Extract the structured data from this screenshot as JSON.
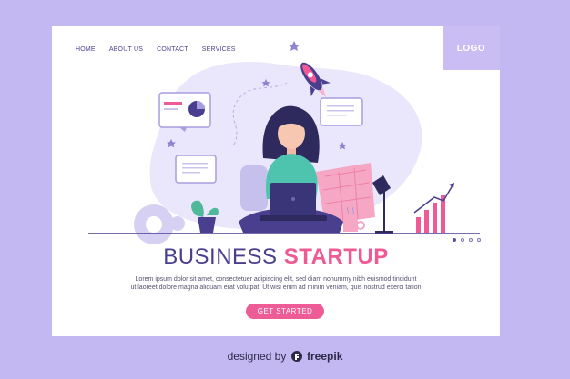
{
  "nav": {
    "items": [
      {
        "label": "HOME"
      },
      {
        "label": "ABOUT US"
      },
      {
        "label": "CONTACT"
      },
      {
        "label": "SERVICES"
      }
    ]
  },
  "logo": {
    "text": "LOGO"
  },
  "hero": {
    "title_part1": "BUSINESS",
    "title_part2": "STARTUP",
    "description_lines": [
      "Lorem ipsum dolor sit amet, consectetuer adipiscing elit, sed diam nonummy nibh euismod tincidunt",
      "ut laoreet dolore magna aliquam erat volutpat. Ut wisi enim ad minim veniam, quis nostrud exerci tation"
    ],
    "cta_label": "GET STARTED"
  },
  "slider": {
    "count": 4,
    "active_index": 0
  },
  "footer": {
    "prefix": "designed by",
    "brand": "freepik"
  },
  "colors": {
    "background": "#c3b8f2",
    "accent_pink": "#ef5a95",
    "primary_purple": "#4a3f8f",
    "logo_box": "#c9bdf3"
  }
}
